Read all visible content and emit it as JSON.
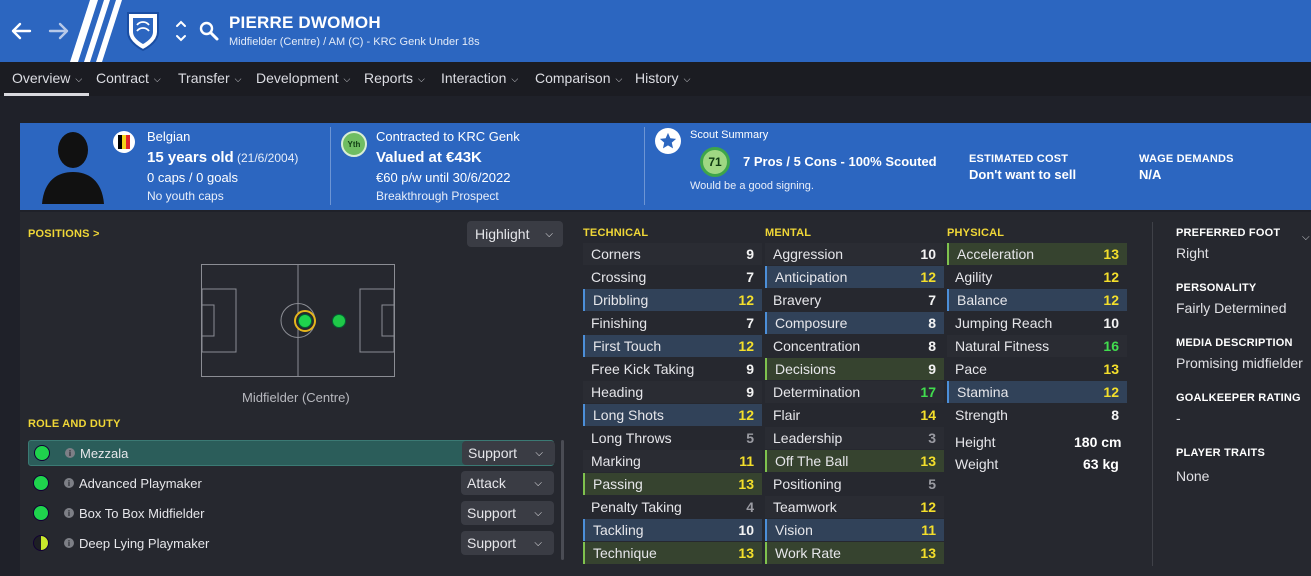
{
  "header": {
    "name": "PIERRE DWOMOH",
    "subtitle": "Midfielder (Centre) / AM (C) - KRC Genk Under 18s"
  },
  "tabs": [
    {
      "label": "Overview"
    },
    {
      "label": "Contract"
    },
    {
      "label": "Transfer"
    },
    {
      "label": "Development"
    },
    {
      "label": "Reports"
    },
    {
      "label": "Interaction"
    },
    {
      "label": "Comparison"
    },
    {
      "label": "History"
    }
  ],
  "info": {
    "nationality": "Belgian",
    "age": "15 years old",
    "dob": "(21/6/2004)",
    "caps": "0 caps / 0 goals",
    "youth_caps": "No youth caps",
    "yth_badge": "Yth",
    "contract": "Contracted to KRC Genk",
    "value": "Valued at €43K",
    "wage": "€60 p/w until 30/6/2022",
    "prospect": "Breakthrough Prospect",
    "scout_title": "Scout Summary",
    "scout_rating": "71",
    "scout_line": "7 Pros / 5 Cons - 100% Scouted",
    "scout_verdict": "Would be a good signing.",
    "cost_label": "ESTIMATED COST",
    "cost_value": "Don't want to sell",
    "wage_label": "WAGE DEMANDS",
    "wage_value": "N/A"
  },
  "positions": {
    "label": "POSITIONS",
    "chevron": ">",
    "highlight": "Highlight",
    "position_name": "Midfielder (Centre)"
  },
  "roles": {
    "label": "ROLE AND DUTY",
    "items": [
      {
        "name": "Mezzala",
        "duty": "Support"
      },
      {
        "name": "Advanced Playmaker",
        "duty": "Attack"
      },
      {
        "name": "Box To Box Midfielder",
        "duty": "Support"
      },
      {
        "name": "Deep Lying Playmaker",
        "duty": "Support"
      }
    ]
  },
  "technical": {
    "label": "TECHNICAL",
    "items": [
      {
        "name": "Corners",
        "value": "9",
        "style": "pl",
        "color": "w"
      },
      {
        "name": "Crossing",
        "value": "7",
        "style": "",
        "color": "w"
      },
      {
        "name": "Dribbling",
        "value": "12",
        "style": "bl",
        "color": "y"
      },
      {
        "name": "Finishing",
        "value": "7",
        "style": "",
        "color": "w"
      },
      {
        "name": "First Touch",
        "value": "12",
        "style": "bl",
        "color": "y"
      },
      {
        "name": "Free Kick Taking",
        "value": "9",
        "style": "",
        "color": "w"
      },
      {
        "name": "Heading",
        "value": "9",
        "style": "pl",
        "color": "w"
      },
      {
        "name": "Long Shots",
        "value": "12",
        "style": "bl",
        "color": "y"
      },
      {
        "name": "Long Throws",
        "value": "5",
        "style": "",
        "color": "gy"
      },
      {
        "name": "Marking",
        "value": "11",
        "style": "pl",
        "color": "y"
      },
      {
        "name": "Passing",
        "value": "13",
        "style": "gr",
        "color": "y"
      },
      {
        "name": "Penalty Taking",
        "value": "4",
        "style": "",
        "color": "gy"
      },
      {
        "name": "Tackling",
        "value": "10",
        "style": "bl",
        "color": "w"
      },
      {
        "name": "Technique",
        "value": "13",
        "style": "gr",
        "color": "y"
      }
    ]
  },
  "mental": {
    "label": "MENTAL",
    "items": [
      {
        "name": "Aggression",
        "value": "10",
        "style": "pl",
        "color": "w"
      },
      {
        "name": "Anticipation",
        "value": "12",
        "style": "bl",
        "color": "y"
      },
      {
        "name": "Bravery",
        "value": "7",
        "style": "",
        "color": "w"
      },
      {
        "name": "Composure",
        "value": "8",
        "style": "bl",
        "color": "w"
      },
      {
        "name": "Concentration",
        "value": "8",
        "style": "",
        "color": "w"
      },
      {
        "name": "Decisions",
        "value": "9",
        "style": "gr",
        "color": "w"
      },
      {
        "name": "Determination",
        "value": "17",
        "style": "pl",
        "color": "g"
      },
      {
        "name": "Flair",
        "value": "14",
        "style": "",
        "color": "y"
      },
      {
        "name": "Leadership",
        "value": "3",
        "style": "pl",
        "color": "gy"
      },
      {
        "name": "Off The Ball",
        "value": "13",
        "style": "gr",
        "color": "y"
      },
      {
        "name": "Positioning",
        "value": "5",
        "style": "",
        "color": "gy"
      },
      {
        "name": "Teamwork",
        "value": "12",
        "style": "pl",
        "color": "y"
      },
      {
        "name": "Vision",
        "value": "11",
        "style": "bl",
        "color": "y"
      },
      {
        "name": "Work Rate",
        "value": "13",
        "style": "gr",
        "color": "y"
      }
    ]
  },
  "physical": {
    "label": "PHYSICAL",
    "items": [
      {
        "name": "Acceleration",
        "value": "13",
        "style": "gr",
        "color": "y"
      },
      {
        "name": "Agility",
        "value": "12",
        "style": "",
        "color": "y"
      },
      {
        "name": "Balance",
        "value": "12",
        "style": "bl",
        "color": "y"
      },
      {
        "name": "Jumping Reach",
        "value": "10",
        "style": "",
        "color": "w"
      },
      {
        "name": "Natural Fitness",
        "value": "16",
        "style": "pl",
        "color": "g"
      },
      {
        "name": "Pace",
        "value": "13",
        "style": "",
        "color": "y"
      },
      {
        "name": "Stamina",
        "value": "12",
        "style": "bl",
        "color": "y"
      },
      {
        "name": "Strength",
        "value": "8",
        "style": "",
        "color": "w"
      }
    ],
    "height_label": "Height",
    "height": "180 cm",
    "weight_label": "Weight",
    "weight": "63 kg"
  },
  "side": {
    "foot_label": "PREFERRED FOOT",
    "foot": "Right",
    "personality_label": "PERSONALITY",
    "personality": "Fairly Determined",
    "media_label": "MEDIA DESCRIPTION",
    "media": "Promising midfielder",
    "gk_label": "GOALKEEPER RATING",
    "gk": "-",
    "traits_label": "PLAYER TRAITS",
    "traits": "None"
  },
  "colors": {
    "topbar": "#2c66c0",
    "accent_yellow": "#f0d737",
    "green": "#41dd4e",
    "role_highlight": "#2b5d5a"
  }
}
